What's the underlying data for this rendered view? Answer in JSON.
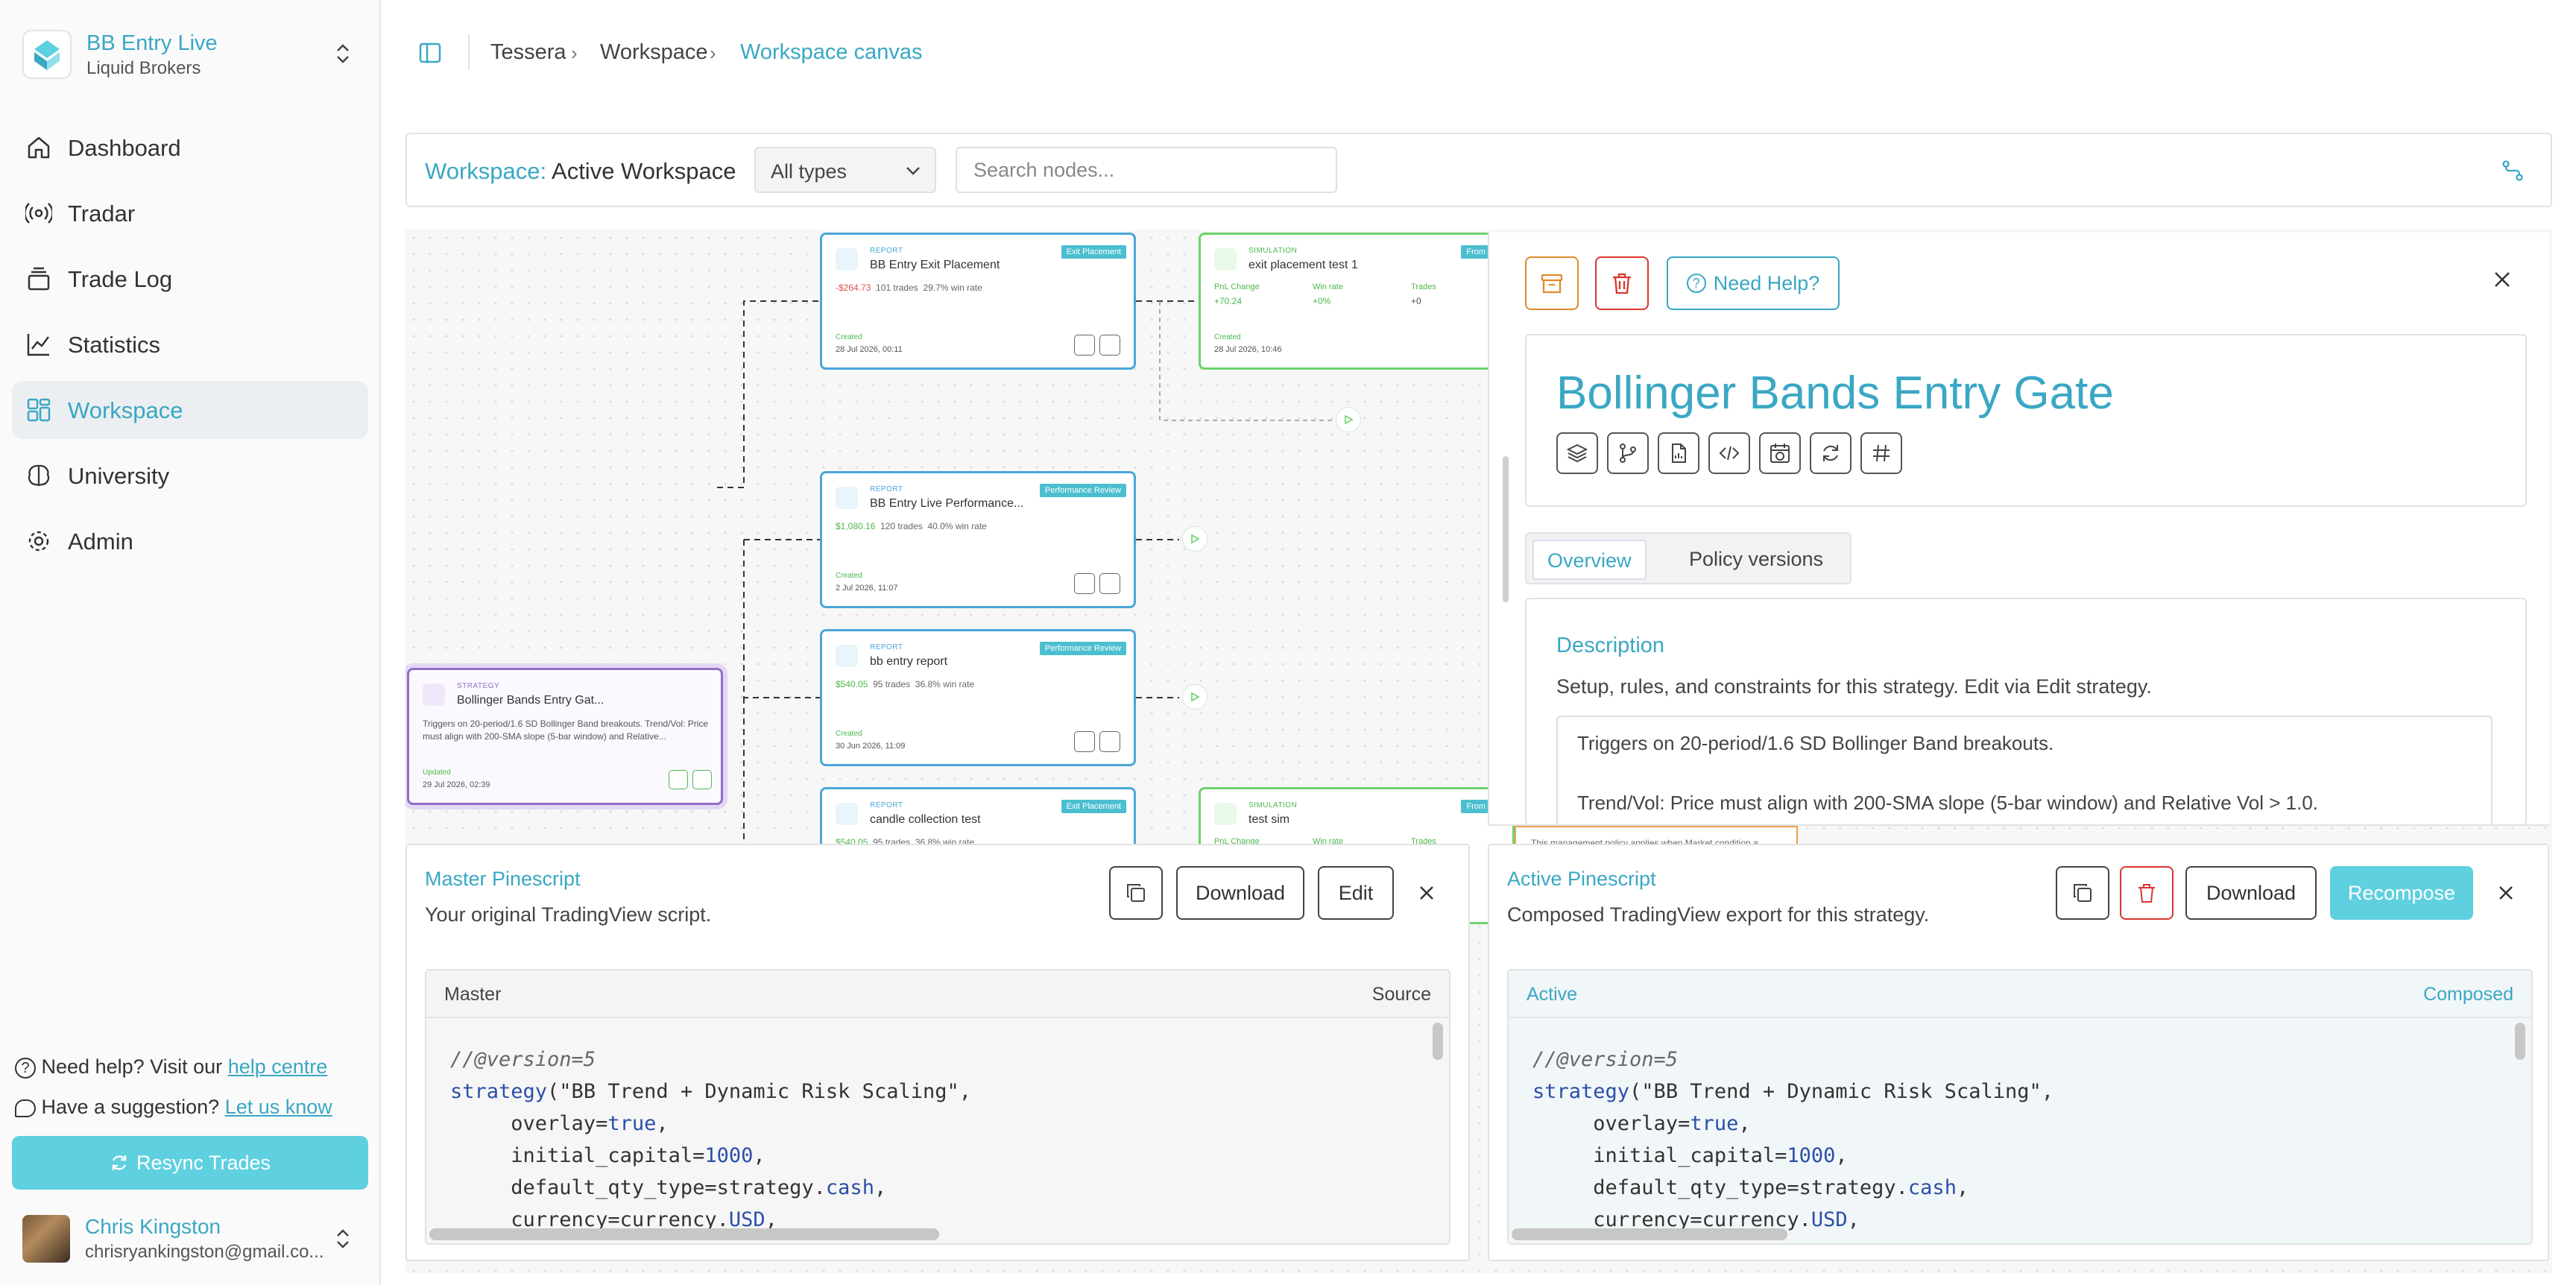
{
  "brand": {
    "title": "BB Entry Live",
    "subtitle": "Liquid Brokers"
  },
  "nav": [
    {
      "label": "Dashboard",
      "icon": "home-icon"
    },
    {
      "label": "Tradar",
      "icon": "radar-icon"
    },
    {
      "label": "Trade Log",
      "icon": "stack-icon"
    },
    {
      "label": "Statistics",
      "icon": "line-chart-icon"
    },
    {
      "label": "Workspace",
      "icon": "layout-icon",
      "active": true
    },
    {
      "label": "University",
      "icon": "brain-icon"
    },
    {
      "label": "Admin",
      "icon": "gear-icon"
    }
  ],
  "help": {
    "need_help": "Need help? Visit our",
    "help_link": "help centre",
    "suggestion": "Have a suggestion?",
    "suggestion_link": "Let us know",
    "resync": "Resync Trades"
  },
  "user": {
    "name": "Chris Kingston",
    "email": "chrisryankingston@gmail.co..."
  },
  "breadcrumb": [
    "Tessera",
    "Workspace",
    "Workspace canvas"
  ],
  "toolbar": {
    "workspace_label": "Workspace:",
    "workspace_value": "Active Workspace",
    "type_select": "All types",
    "search_placeholder": "Search nodes..."
  },
  "nodes": {
    "r1": {
      "kind": "REPORT",
      "title": "BB Entry Exit Placement",
      "badge": "Exit Placement",
      "pnl": "-$264.73",
      "trades": "101 trades",
      "winrate": "29.7% win rate",
      "created_label": "Created",
      "created": "28 Jul 2026, 00:11"
    },
    "r2": {
      "kind": "REPORT",
      "title": "BB Entry Live Performance...",
      "badge": "Performance Review",
      "pnl": "$1,080.16",
      "trades": "120 trades",
      "winrate": "40.0% win rate",
      "created_label": "Created",
      "created": "2 Jul 2026, 11:07"
    },
    "r3": {
      "kind": "REPORT",
      "title": "bb entry report",
      "badge": "Performance Review",
      "pnl": "$540.05",
      "trades": "95 trades",
      "winrate": "36.8% win rate",
      "created_label": "Created",
      "created": "30 Jun 2026, 11:09"
    },
    "r4": {
      "kind": "REPORT",
      "title": "candle collection test",
      "badge": "Exit Placement",
      "pnl": "$540.05",
      "trades": "95 trades",
      "winrate": "36.8% win rate"
    },
    "s1": {
      "kind": "SIMULATION",
      "title": "exit placement test 1",
      "badge": "From rep",
      "pnl_label": "PnL Change",
      "pnl": "+70.24",
      "win_label": "Win rate",
      "win": "+0%",
      "trades_label": "Trades",
      "trades": "+0",
      "created_label": "Created",
      "created": "28 Jul 2026, 10:46"
    },
    "s2": {
      "kind": "SIMULATION",
      "title": "test sim",
      "badge": "From rep",
      "pnl_label": "PnL Change",
      "win_label": "Win rate",
      "trades_label": "Trades"
    },
    "st": {
      "kind": "STRATEGY",
      "title": "Bollinger Bands Entry Gat...",
      "desc": "Triggers on 20-period/1.6 SD Bollinger Band breakouts. Trend/Vol: Price must align with 200-SMA slope (5-bar window) and Relative...",
      "updated_label": "Updated",
      "updated": "29 Jul 2026, 02:39"
    },
    "policy_snippet": "This management policy applies when Market condition a..."
  },
  "detail": {
    "help_button": "Need Help?",
    "title": "Bollinger Bands Entry Gate",
    "tabs": [
      "Overview",
      "Policy versions"
    ],
    "desc_heading": "Description",
    "desc_sub": "Setup, rules, and constraints for this strategy. Edit via Edit strategy.",
    "desc_line1": "Triggers on 20-period/1.6 SD Bollinger Band breakouts.",
    "desc_line2": "Trend/Vol: Price must align with 200-SMA slope (5-bar window) and Relative Vol > 1.0."
  },
  "master": {
    "title": "Master Pinescript",
    "subtitle": "Your original TradingView script.",
    "download": "Download",
    "edit": "Edit",
    "head_left": "Master",
    "head_right": "Source"
  },
  "active": {
    "title": "Active Pinescript",
    "subtitle": "Composed TradingView export for this strategy.",
    "download": "Download",
    "recompose": "Recompose",
    "head_left": "Active",
    "head_right": "Composed"
  },
  "code": {
    "l1": "//@version=5",
    "l2a": "strategy",
    "l2b": "(\"BB Trend + Dynamic Risk Scaling\",",
    "l3a": "     overlay=",
    "l3b": "true",
    "l3c": ",",
    "l4a": "     initial_capital=",
    "l4b": "1000",
    "l4c": ",",
    "l5a": "     default_qty_type=strategy.",
    "l5b": "cash",
    "l5c": ",",
    "l6a": "     currency=currency.",
    "l6b": "USD",
    "l6c": ","
  },
  "colors": {
    "accent": "#3aa7c4",
    "primary_button": "#5fd0df",
    "danger": "#d9362f",
    "report_border": "#4aa6d8",
    "sim_border": "#6dd36d",
    "strategy_border": "#8f6fc6"
  }
}
